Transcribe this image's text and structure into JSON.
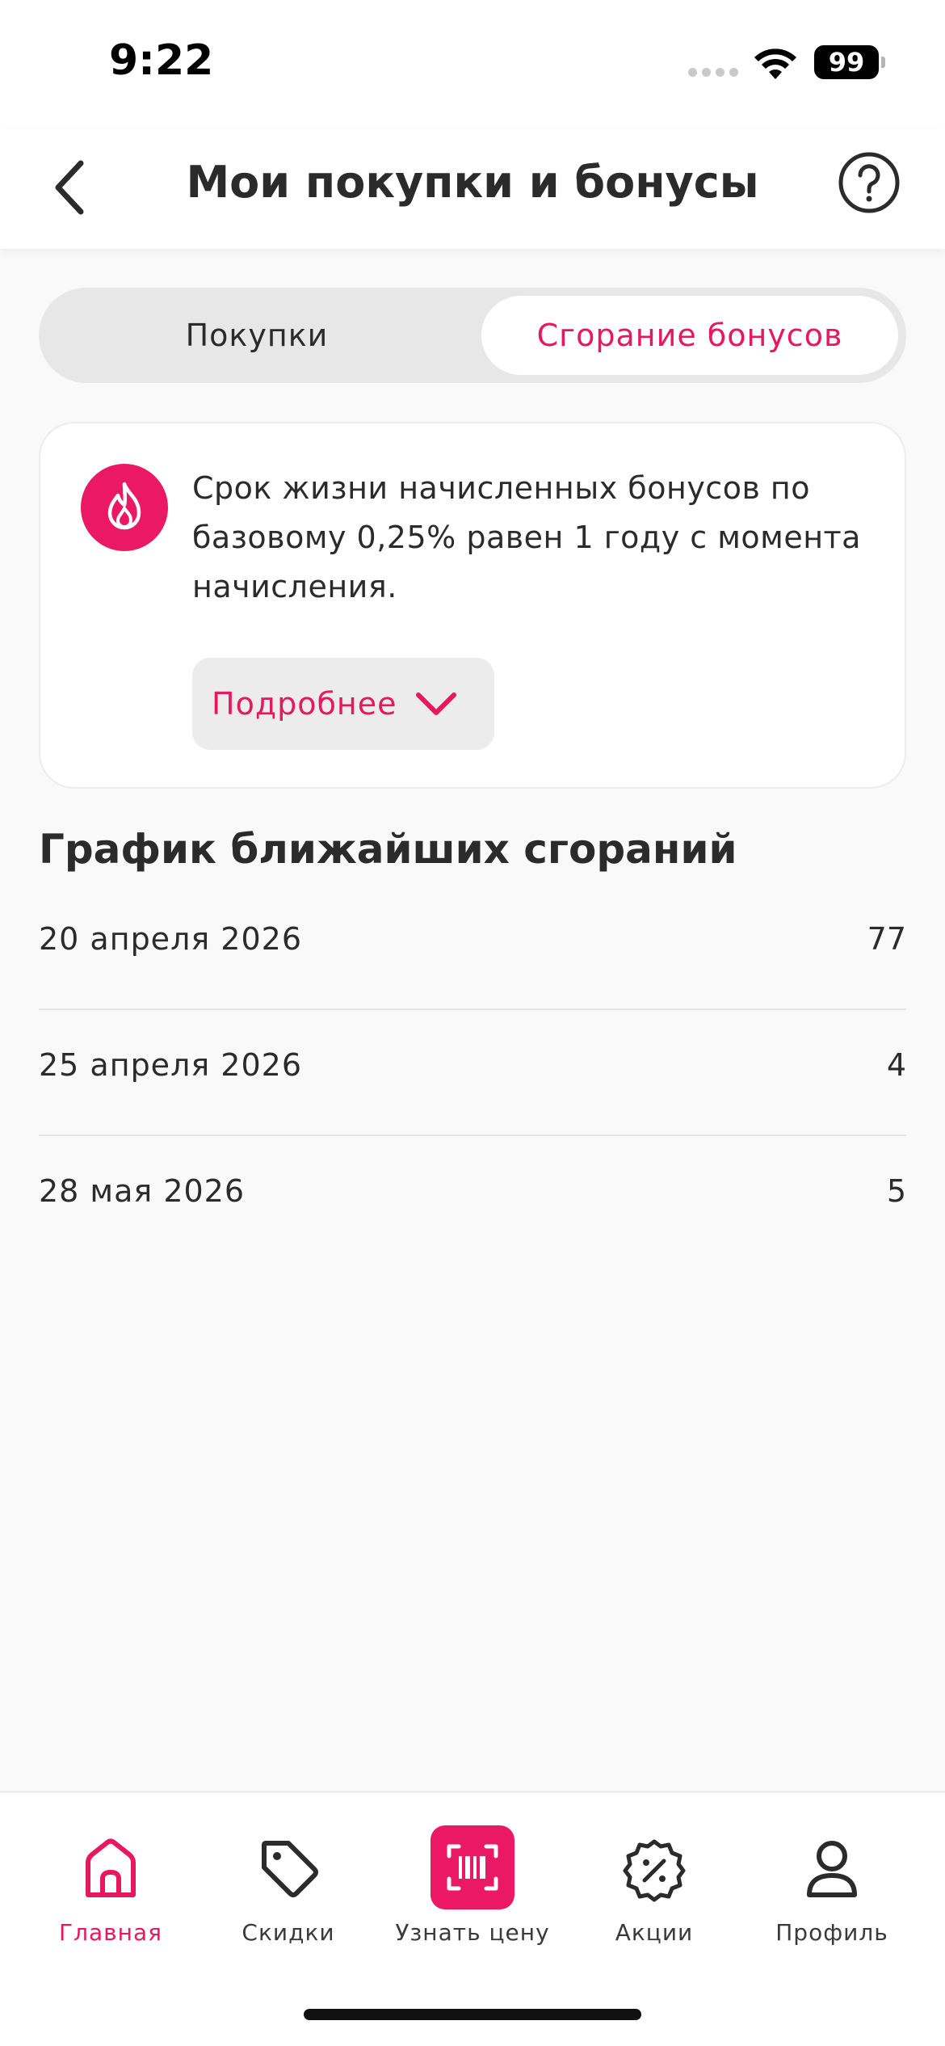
{
  "status_bar": {
    "time": "9:22",
    "battery": "99"
  },
  "header": {
    "title": "Мои покупки и бонусы"
  },
  "tabs": [
    {
      "label": "Покупки",
      "active": false
    },
    {
      "label": "Сгорание бонусов",
      "active": true
    }
  ],
  "info_card": {
    "text": "Срок жизни начисленных бонусов по базовому 0,25% равен 1 году с момента начисления.",
    "more_label": "Подробнее",
    "icon": "flame-icon"
  },
  "schedule": {
    "title": "График ближайших сгораний",
    "rows": [
      {
        "date": "20 апреля 2026",
        "amount": "77"
      },
      {
        "date": "25 апреля 2026",
        "amount": "4"
      },
      {
        "date": "28 мая 2026",
        "amount": "5"
      }
    ]
  },
  "bottom_nav": [
    {
      "label": "Главная",
      "icon": "home-icon",
      "active": true
    },
    {
      "label": "Скидки",
      "icon": "tag-icon",
      "active": false
    },
    {
      "label": "Узнать цену",
      "icon": "barcode-scan-icon",
      "active": false
    },
    {
      "label": "Акции",
      "icon": "percent-badge-icon",
      "active": false
    },
    {
      "label": "Профиль",
      "icon": "profile-icon",
      "active": false
    }
  ],
  "colors": {
    "accent": "#e8185f",
    "background": "#f9f9f9",
    "tab_track": "#e7e7e7"
  }
}
